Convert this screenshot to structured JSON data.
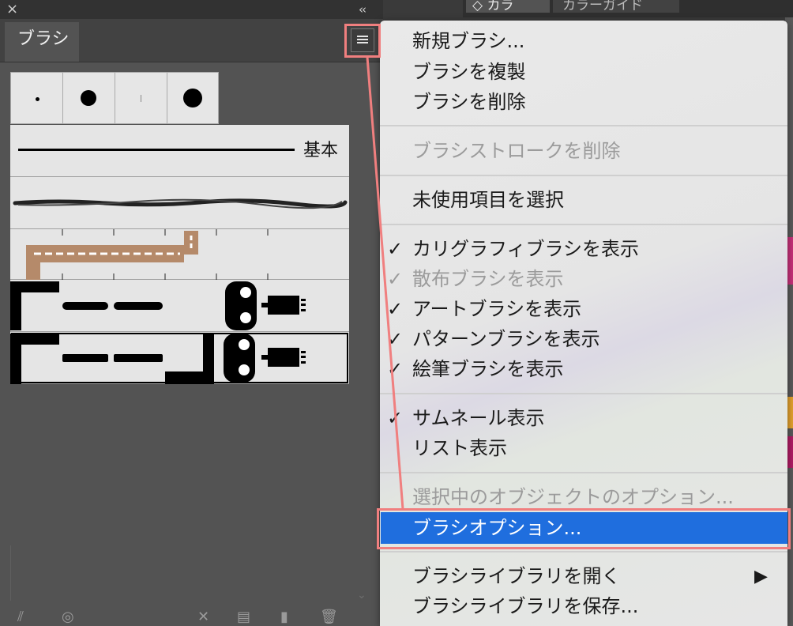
{
  "panel": {
    "tab_label": "ブラシ",
    "close_glyph": "×",
    "collapse_glyph": "‹‹",
    "basic_brush_label": "基本",
    "bottom_icons": [
      "brush-libraries-icon",
      "place-brush-icon",
      "remove-stroke-icon",
      "options-icon",
      "new-brush-icon",
      "delete-icon"
    ]
  },
  "top_tabs": {
    "color": "◇ カラ",
    "guide": "カラーガイド"
  },
  "menu": {
    "items": [
      {
        "label": "新規ブラシ...",
        "enabled": true,
        "checked": false
      },
      {
        "label": "ブラシを複製",
        "enabled": true,
        "checked": false
      },
      {
        "label": "ブラシを削除",
        "enabled": true,
        "checked": false
      },
      {
        "label": "ブラシストロークを削除",
        "enabled": false,
        "checked": false
      },
      {
        "label": "未使用項目を選択",
        "enabled": true,
        "checked": false
      },
      {
        "label": "カリグラフィブラシを表示",
        "enabled": true,
        "checked": true
      },
      {
        "label": "散布ブラシを表示",
        "enabled": false,
        "checked": true
      },
      {
        "label": "アートブラシを表示",
        "enabled": true,
        "checked": true
      },
      {
        "label": "パターンブラシを表示",
        "enabled": true,
        "checked": true
      },
      {
        "label": "絵筆ブラシを表示",
        "enabled": true,
        "checked": true
      },
      {
        "label": "サムネール表示",
        "enabled": true,
        "checked": true
      },
      {
        "label": "リスト表示",
        "enabled": true,
        "checked": false
      },
      {
        "label": "選択中のオブジェクトのオプション...",
        "enabled": false,
        "checked": false
      },
      {
        "label": "ブラシオプション...",
        "enabled": true,
        "checked": false,
        "highlighted": true
      },
      {
        "label": "ブラシライブラリを開く",
        "enabled": true,
        "checked": false,
        "submenu": true
      },
      {
        "label": "ブラシライブラリを保存...",
        "enabled": true,
        "checked": false
      }
    ],
    "check_glyph": "✓",
    "submenu_glyph": "▶"
  },
  "colors": {
    "highlight": "#1f6ede",
    "annotation": "#f07f7f"
  }
}
